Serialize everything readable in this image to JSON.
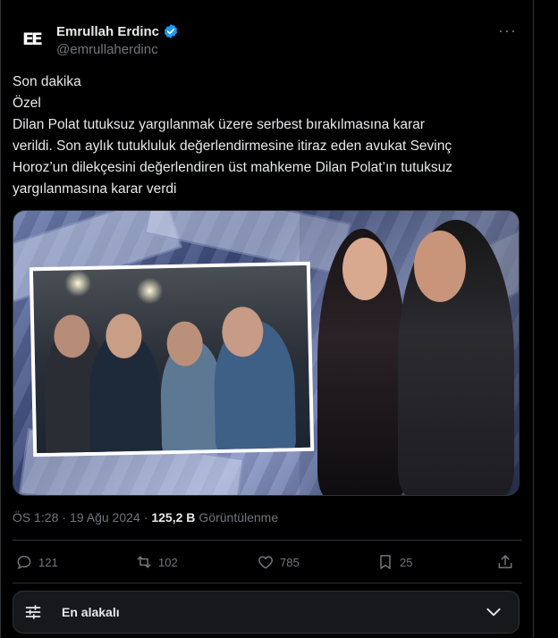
{
  "author": {
    "avatar_text": "EE",
    "name": "Emrullah Erdinc",
    "handle": "@emrullaherdinc"
  },
  "tweet": {
    "lines": [
      "Son dakika",
      "Özel",
      "Dilan Polat tutuksuz yargılanmak üzere serbest bırakılmasına karar",
      "verildi. Son aylık tutukluluk değerlendirmesine itiraz eden avukat Sevinç",
      "Horoz’un dilekçesini değerlendiren üst mahkeme Dilan Polat’ın tutuksuz",
      "yargılanmasına karar verdi"
    ]
  },
  "meta": {
    "time": "ÖS 1:28",
    "separator": "·",
    "date": "19 Ağu 2024",
    "views_count": "125,2 B",
    "views_label": "Görüntülenme"
  },
  "actions": {
    "replies": "121",
    "reposts": "102",
    "likes": "785",
    "bookmarks": "25"
  },
  "sort": {
    "label": "En alakalı"
  },
  "colors": {
    "background": "#000000",
    "text": "#e7e9ea",
    "secondary": "#71767b",
    "verified": "#1d9bf0",
    "border": "#2f3336"
  }
}
